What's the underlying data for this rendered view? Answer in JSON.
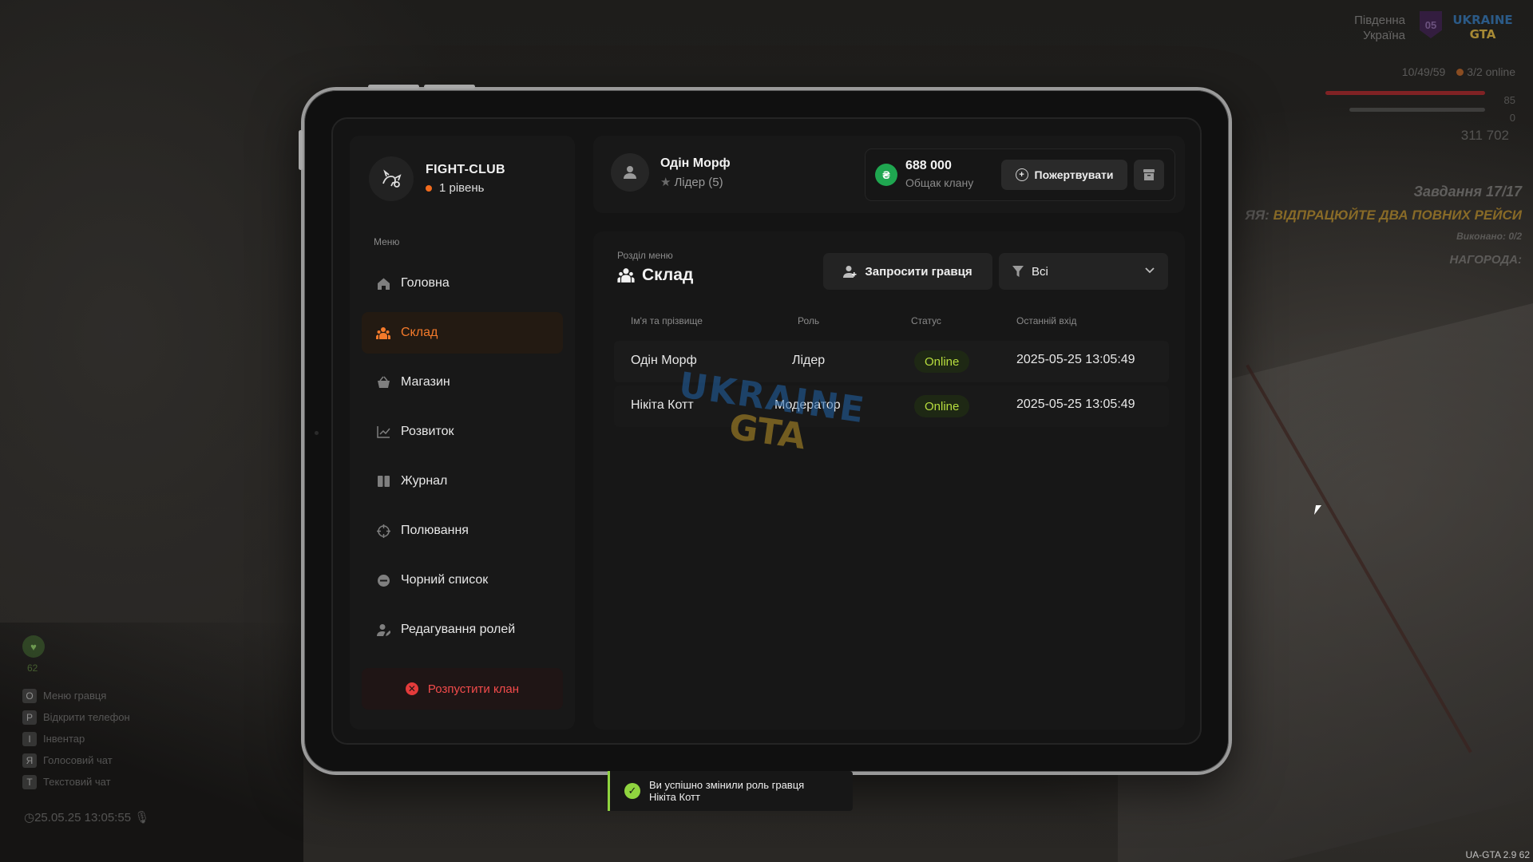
{
  "hud": {
    "region_line1": "Південна",
    "region_line2": "Україна",
    "server_number": "05",
    "logo_line1": "UKRAINE",
    "logo_line2": "GTA",
    "players": "10/49/59",
    "online": "3/2 online",
    "health": "85",
    "armor": "0",
    "money": "311 702",
    "quest_title": "Завдання 17/17",
    "quest_prefix": "ЯЯ:",
    "quest_task": "ВІДПРАЦЮЙТЕ ДВА ПОВНИХ РЕЙСИ",
    "quest_done": "Виконано: 0/2",
    "quest_reward": "НАГОРОДА:",
    "hp_label": "62",
    "keybinds": [
      {
        "key": "O",
        "label": "Меню гравця"
      },
      {
        "key": "P",
        "label": "Відкрити телефон"
      },
      {
        "key": "I",
        "label": "Інвентар"
      },
      {
        "key": "Я",
        "label": "Голосовий чат"
      },
      {
        "key": "T",
        "label": "Текстовий чат"
      }
    ],
    "clock": "25.05.25 13:05:55",
    "version": "UA-GTA 2.9   62"
  },
  "clan": {
    "name": "FIGHT-CLUB",
    "level": "1 рівень"
  },
  "menu": {
    "title": "Меню",
    "items": [
      {
        "label": "Головна",
        "icon": "home-icon"
      },
      {
        "label": "Склад",
        "icon": "users-icon",
        "active": true
      },
      {
        "label": "Магазин",
        "icon": "basket-icon"
      },
      {
        "label": "Розвиток",
        "icon": "chart-icon"
      },
      {
        "label": "Журнал",
        "icon": "book-icon"
      },
      {
        "label": "Полювання",
        "icon": "crosshair-icon"
      },
      {
        "label": "Чорний список",
        "icon": "block-icon"
      },
      {
        "label": "Редагування ролей",
        "icon": "user-edit-icon"
      }
    ],
    "disband_label": "Розпустити клан"
  },
  "user": {
    "name": "Одін Морф",
    "role": "Лідер (5)"
  },
  "fund": {
    "amount": "688 000",
    "label": "Общак клану",
    "donate_label": "Пожертвувати"
  },
  "section": {
    "subtitle": "Розділ меню",
    "title": "Склад",
    "invite_label": "Запросити гравця",
    "filter_value": "Всі"
  },
  "table": {
    "headers": [
      "Ім'я та прізвище",
      "Роль",
      "Статус",
      "Останній вхід"
    ],
    "rows": [
      {
        "name": "Одін Морф",
        "role": "Лідер",
        "status": "Online",
        "last": "2025-05-25 13:05:49"
      },
      {
        "name": "Нікіта Котт",
        "role": "Модератор",
        "status": "Online",
        "last": "2025-05-25 13:05:49"
      }
    ]
  },
  "watermark": {
    "line1": "UKRAINE",
    "line2": "GTA"
  },
  "toast": {
    "line1": "Ви успішно змінили роль гравця",
    "line2": "Нікіта Котт"
  },
  "colors": {
    "accent": "#f47a2b",
    "online": "#b7dd3e",
    "danger": "#f24b4b",
    "coin": "#1fa650",
    "success": "#8fd43f"
  }
}
